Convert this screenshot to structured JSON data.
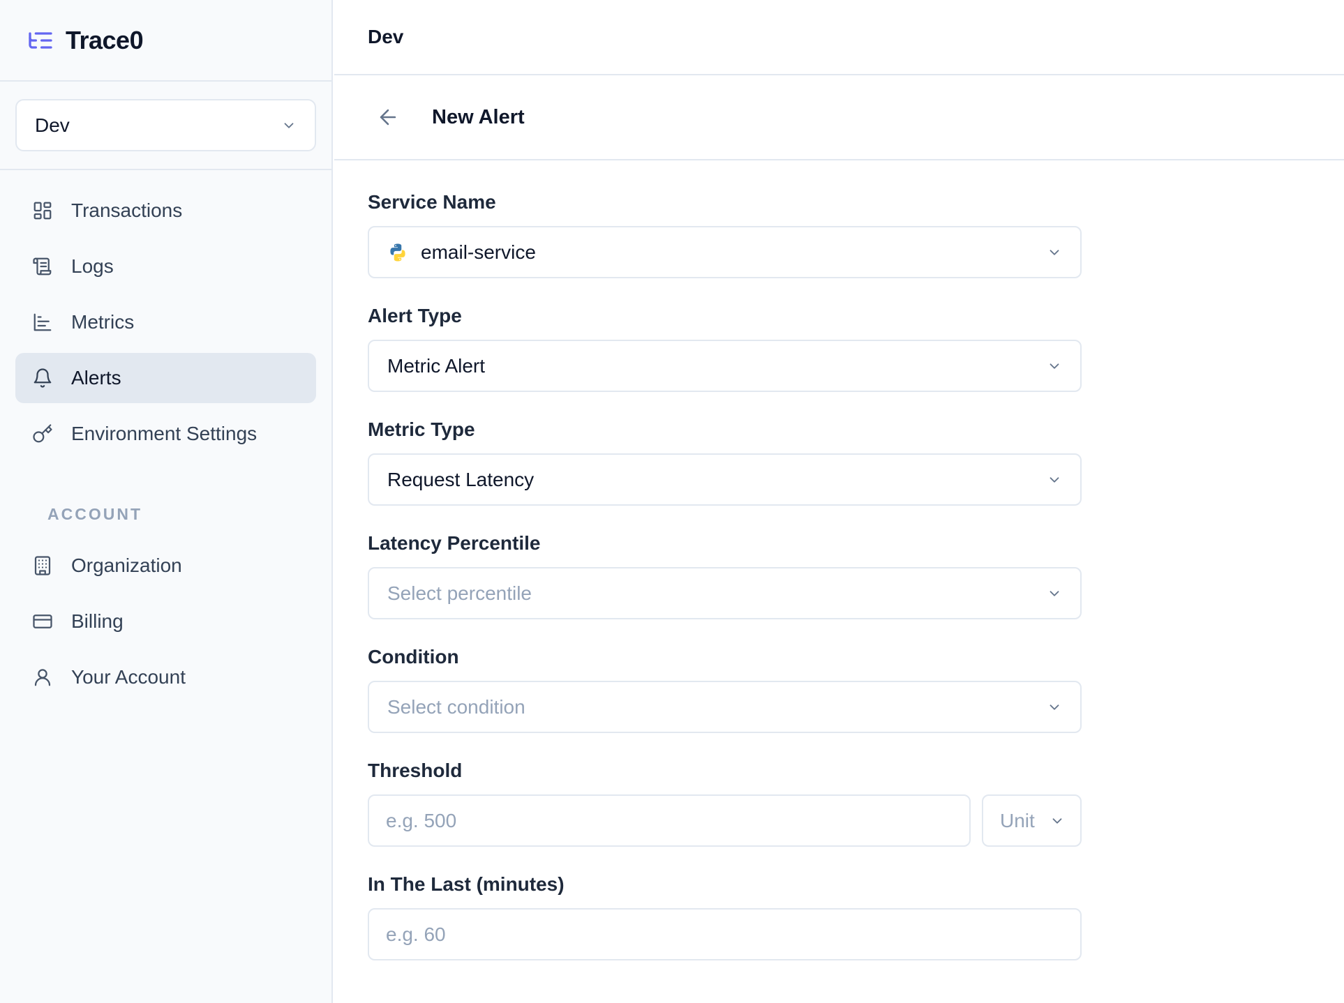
{
  "brand": {
    "name": "Trace0",
    "icon": "list-tree-icon",
    "accent": "#6366f1"
  },
  "environment_selector": {
    "value": "Dev"
  },
  "sidebar": {
    "items": [
      {
        "label": "Transactions",
        "icon": "dashboard-grid-icon",
        "active": false
      },
      {
        "label": "Logs",
        "icon": "scroll-icon",
        "active": false
      },
      {
        "label": "Metrics",
        "icon": "bar-chart-icon",
        "active": false
      },
      {
        "label": "Alerts",
        "icon": "bell-icon",
        "active": true
      },
      {
        "label": "Environment Settings",
        "icon": "key-icon",
        "active": false
      }
    ],
    "account_label": "ACCOUNT",
    "account_items": [
      {
        "label": "Organization",
        "icon": "building-icon"
      },
      {
        "label": "Billing",
        "icon": "credit-card-icon"
      },
      {
        "label": "Your Account",
        "icon": "user-icon"
      }
    ]
  },
  "topbar": {
    "title": "Dev"
  },
  "page": {
    "title": "New Alert"
  },
  "form": {
    "service_name": {
      "label": "Service Name",
      "value": "email-service",
      "icon": "python-icon"
    },
    "alert_type": {
      "label": "Alert Type",
      "value": "Metric Alert"
    },
    "metric_type": {
      "label": "Metric Type",
      "value": "Request Latency"
    },
    "latency_percentile": {
      "label": "Latency Percentile",
      "placeholder": "Select percentile"
    },
    "condition": {
      "label": "Condition",
      "placeholder": "Select condition"
    },
    "threshold": {
      "label": "Threshold",
      "placeholder": "e.g. 500",
      "unit_placeholder": "Unit"
    },
    "in_the_last": {
      "label": "In The Last (minutes)",
      "placeholder": "e.g. 60"
    }
  }
}
